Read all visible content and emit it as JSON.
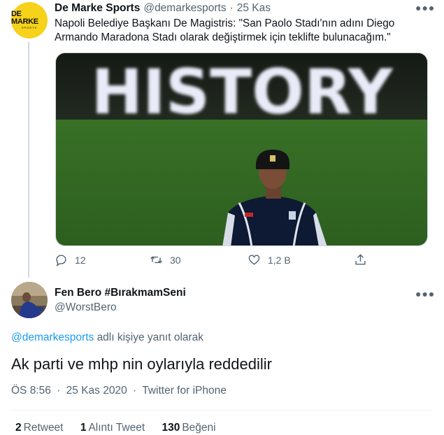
{
  "original_tweet": {
    "avatar": {
      "logo_main": "DE MARKE",
      "logo_sub": "SPORTS"
    },
    "display_name": "De Marke Sports",
    "handle": "@demarkesports",
    "separator": "·",
    "time": "25 Kas",
    "more_icon": "more-horizontal-icon",
    "text": "Napoli Belediye Başkanı De Magistris: \"San Paolo Stadı'nın adını Diego Armando Maradona Stadı olarak değiştirmek için teklifte bulunacağım.\"",
    "media": {
      "banner_text": "HISTORY"
    },
    "actions": {
      "reply_count": "12",
      "retweet_count": "30",
      "like_count": "1,2 B"
    }
  },
  "reply_tweet": {
    "display_name": "Fen Bero #BırakmamSeni",
    "handle": "@WorstBero",
    "more_icon": "more-horizontal-icon",
    "replying_to_handle": "@demarkesports",
    "replying_to_suffix": "adlı kişiye yanıt olarak",
    "text": "Ak parti ve mhp nin oylarıyla reddedilir",
    "time": "ÖS 8:56",
    "date": "25 Kas 2020",
    "separator": "·",
    "source": "Twitter for iPhone",
    "stats": {
      "retweets_count": "2",
      "retweets_label": "Retweet",
      "quotes_count": "1",
      "quotes_label": "Alıntı Tweet",
      "likes_count": "130",
      "likes_label": "Beğeni"
    }
  },
  "colors": {
    "text_primary": "#0f1419",
    "text_secondary": "#536471",
    "link": "#1d9bf0",
    "avatar_yellow": "#f6d21a",
    "thread_line": "#cfd9de"
  }
}
